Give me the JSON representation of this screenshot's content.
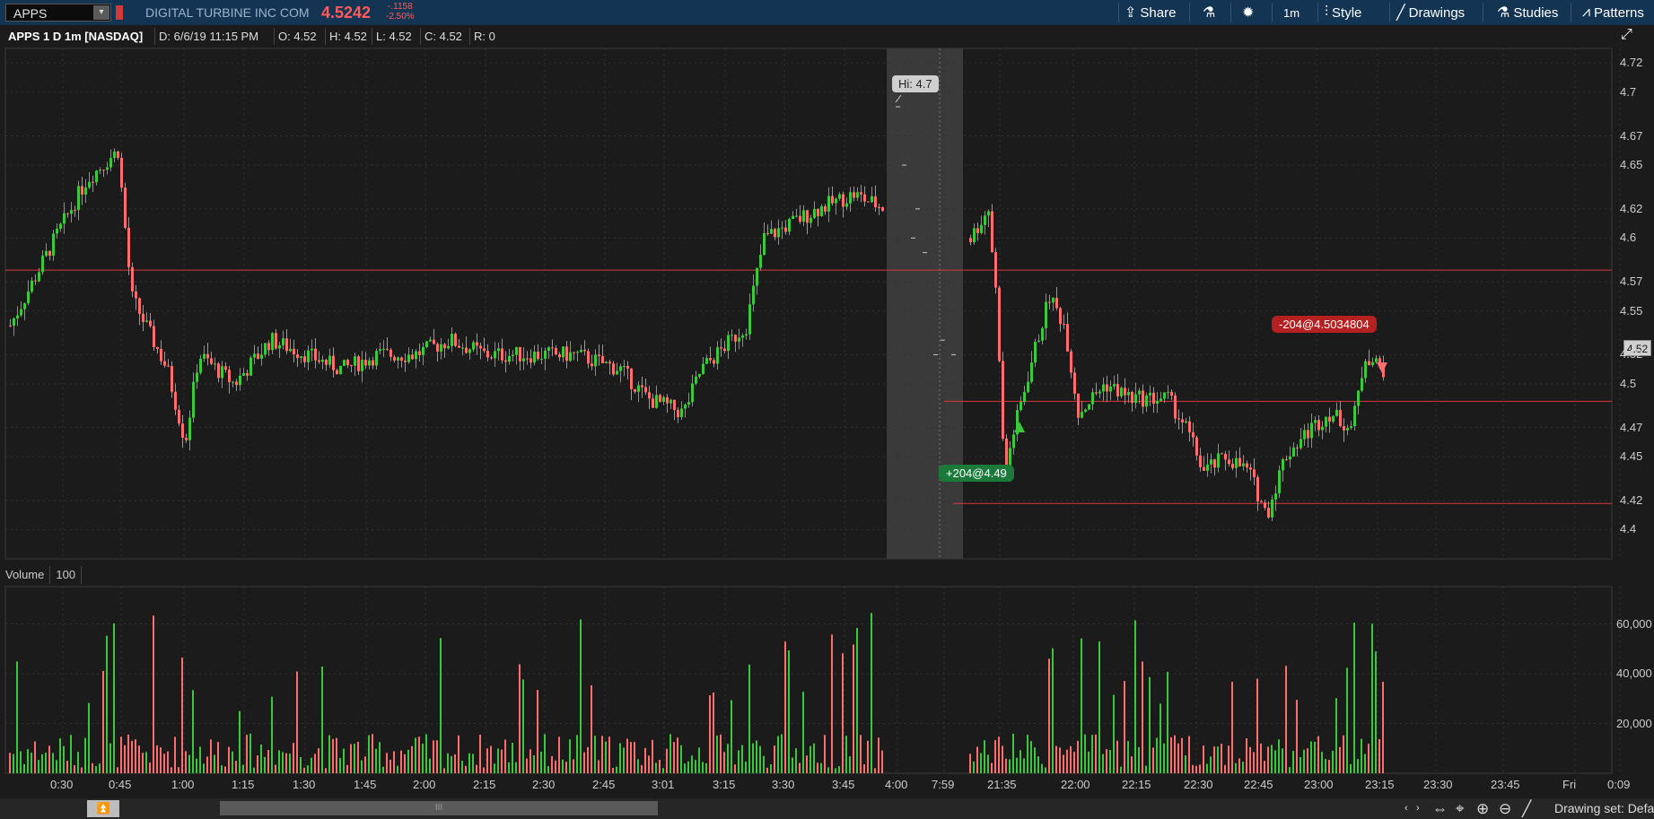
{
  "header": {
    "symbol": "APPS",
    "dropdown_glyph": "▾",
    "company": "DIGITAL TURBINE INC COM",
    "last_price": "4.5242",
    "net_change": "-.1158",
    "pct_change": "-2.50%",
    "buttons": [
      {
        "label": "Share",
        "icon": "share-icon"
      },
      {
        "label": "",
        "icon": "flask-icon"
      },
      {
        "label": "",
        "icon": "gear-icon"
      },
      {
        "label": "1m",
        "icon": ""
      },
      {
        "label": "Style",
        "icon": "candle-style-icon"
      },
      {
        "label": "Drawings",
        "icon": "pencil-icon"
      },
      {
        "label": "Studies",
        "icon": "flask-icon"
      },
      {
        "label": "Patterns",
        "icon": "pattern-icon"
      }
    ]
  },
  "infobar": {
    "title": "APPS 1 D 1m [NASDAQ]",
    "date": "D: 6/6/19 11:15 PM",
    "open": "O: 4.52",
    "high": "H: 4.52",
    "low": "L: 4.52",
    "close": "C: 4.52",
    "range": "R: 0"
  },
  "price_axis": {
    "ticks": [
      "4.72",
      "4.7",
      "4.67",
      "4.65",
      "4.62",
      "4.6",
      "4.57",
      "4.55",
      "4.52",
      "4.5",
      "4.47",
      "4.45",
      "4.42",
      "4.4"
    ],
    "current": "4.52"
  },
  "volume_pane": {
    "label": "Volume",
    "value": "100",
    "ticks": [
      "60,000",
      "40,000",
      "20,000"
    ]
  },
  "time_axis": [
    "0:30",
    "0:45",
    "1:00",
    "1:15",
    "1:30",
    "1:45",
    "2:00",
    "2:15",
    "2:30",
    "2:45",
    "3:01",
    "3:15",
    "3:30",
    "3:45",
    "4:00",
    "7:59",
    "21:35",
    "22:00",
    "22:15",
    "22:30",
    "22:45",
    "23:00",
    "23:15",
    "23:30",
    "23:45",
    "Fri",
    "0:09"
  ],
  "annotations": {
    "hi": "Hi: 4.7",
    "buy": "+204@4.49",
    "sell": "-204@4.5034804"
  },
  "footer": {
    "drawing_set": "Drawing set: Defa",
    "scroll_glyph": "⏫",
    "thumb_glyph": "III"
  },
  "colors": {
    "up": "#3cc83c",
    "down": "#ff6e6e",
    "topbar": "#133453",
    "hline": "#d63a3a"
  },
  "chart_data": {
    "type": "candlestick",
    "symbol": "APPS",
    "interval": "1m",
    "ylim": [
      4.38,
      4.73
    ],
    "horizontal_lines": [
      4.578,
      4.488,
      4.418
    ],
    "current_price": 4.52,
    "session_high": 4.7,
    "trades": [
      {
        "side": "buy",
        "qty": 204,
        "price": 4.49
      },
      {
        "side": "sell",
        "qty": 204,
        "price": 4.5034804
      }
    ],
    "volume_ylim": [
      0,
      75000
    ]
  }
}
